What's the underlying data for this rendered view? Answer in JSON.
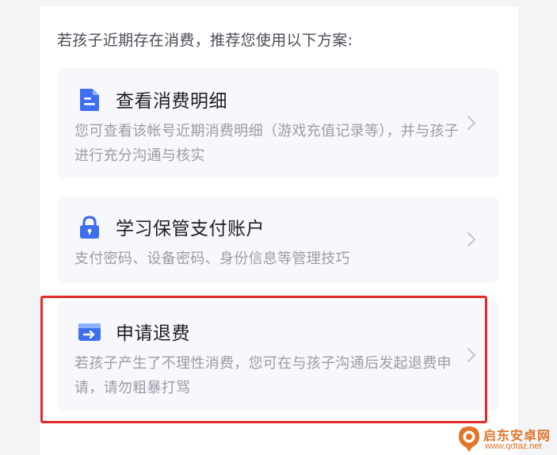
{
  "intro_text": "若孩子近期存在消费，推荐您使用以下方案:",
  "cards": [
    {
      "icon": "document-icon",
      "title": "查看消费明细",
      "description": "您可查看该帐号近期消费明细（游戏充值记录等），并与孩子进行充分沟通与核实"
    },
    {
      "icon": "lock-icon",
      "title": "学习保管支付账户",
      "description": "支付密码、设备密码、身份信息等管理技巧"
    },
    {
      "icon": "refund-card-icon",
      "title": "申请退费",
      "description": "若孩子产生了不理性消费，您可在与孩子沟通后发起退费申请，请勿粗暴打骂"
    }
  ],
  "watermark": {
    "main": "启东安卓网",
    "sub": "www.qdtaz.net"
  },
  "colors": {
    "accent": "#3d6ff0",
    "highlight": "#e22b2b",
    "card_bg": "#f7f8fc",
    "watermark": "#e3742a"
  }
}
